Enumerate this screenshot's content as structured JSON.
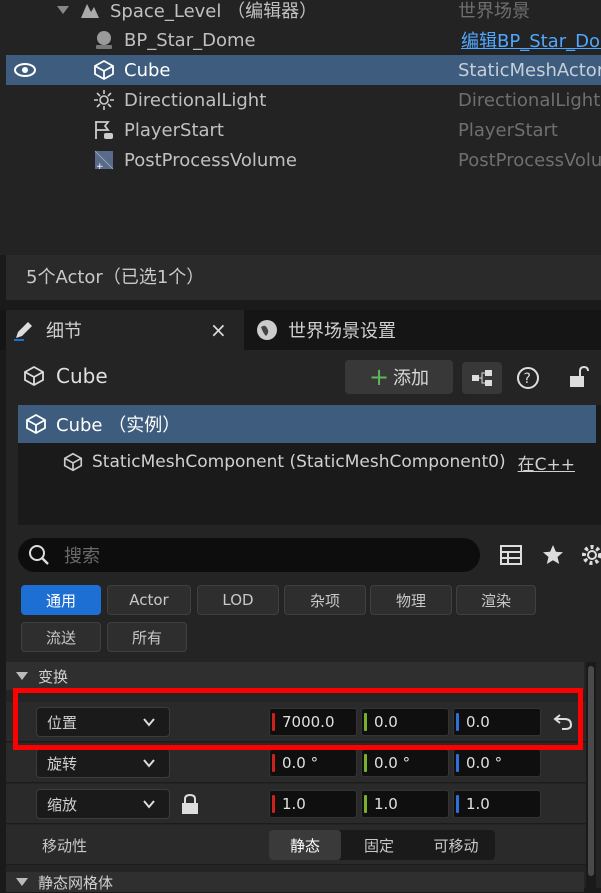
{
  "outliner": {
    "rows": [
      {
        "name": "Space_Level （编辑器）",
        "type": "世界场景",
        "icon": "level-icon"
      },
      {
        "name": "BP_Star_Dome",
        "type": "编辑BP_Star_Dome",
        "icon": "blueprint-sphere-icon"
      },
      {
        "name": "Cube",
        "type": "StaticMeshActor",
        "icon": "cube-icon"
      },
      {
        "name": "DirectionalLight",
        "type": "DirectionalLight",
        "icon": "sun-icon"
      },
      {
        "name": "PlayerStart",
        "type": "PlayerStart",
        "icon": "player-start-icon"
      },
      {
        "name": "PostProcessVolume",
        "type": "PostProcessVolume",
        "icon": "volume-icon"
      }
    ],
    "status": "5个Actor（已选1个）"
  },
  "tabs": {
    "details": "细节",
    "world_settings": "世界场景设置",
    "close": "×"
  },
  "details": {
    "actor_name": "Cube",
    "add_label": "添加",
    "components": [
      {
        "label": "Cube （实例）"
      },
      {
        "label": "StaticMeshComponent (StaticMeshComponent0)",
        "extra": "在C++"
      }
    ],
    "search_placeholder": "搜索",
    "filters": [
      "通用",
      "Actor",
      "LOD",
      "杂项",
      "物理",
      "渲染",
      "流送",
      "所有"
    ],
    "section_transform": "变换",
    "location": {
      "label": "位置",
      "x": "7000.0",
      "y": "0.0",
      "z": "0.0"
    },
    "rotation": {
      "label": "旋转",
      "x": "0.0 °",
      "y": "0.0 °",
      "z": "0.0 °"
    },
    "scale": {
      "label": "缩放",
      "x": "1.0",
      "y": "1.0",
      "z": "1.0"
    },
    "mobility": {
      "label": "移动性",
      "options": [
        "静态",
        "固定",
        "可移动"
      ],
      "selected": "静态"
    },
    "section_mesh": "静态网格体"
  },
  "colors": {
    "accent": "#1e6fd4",
    "selection": "#3e5d7e",
    "x_axis": "#c8241c",
    "y_axis": "#7ab12a",
    "z_axis": "#2e6fd8",
    "highlight": "#ff0000"
  }
}
